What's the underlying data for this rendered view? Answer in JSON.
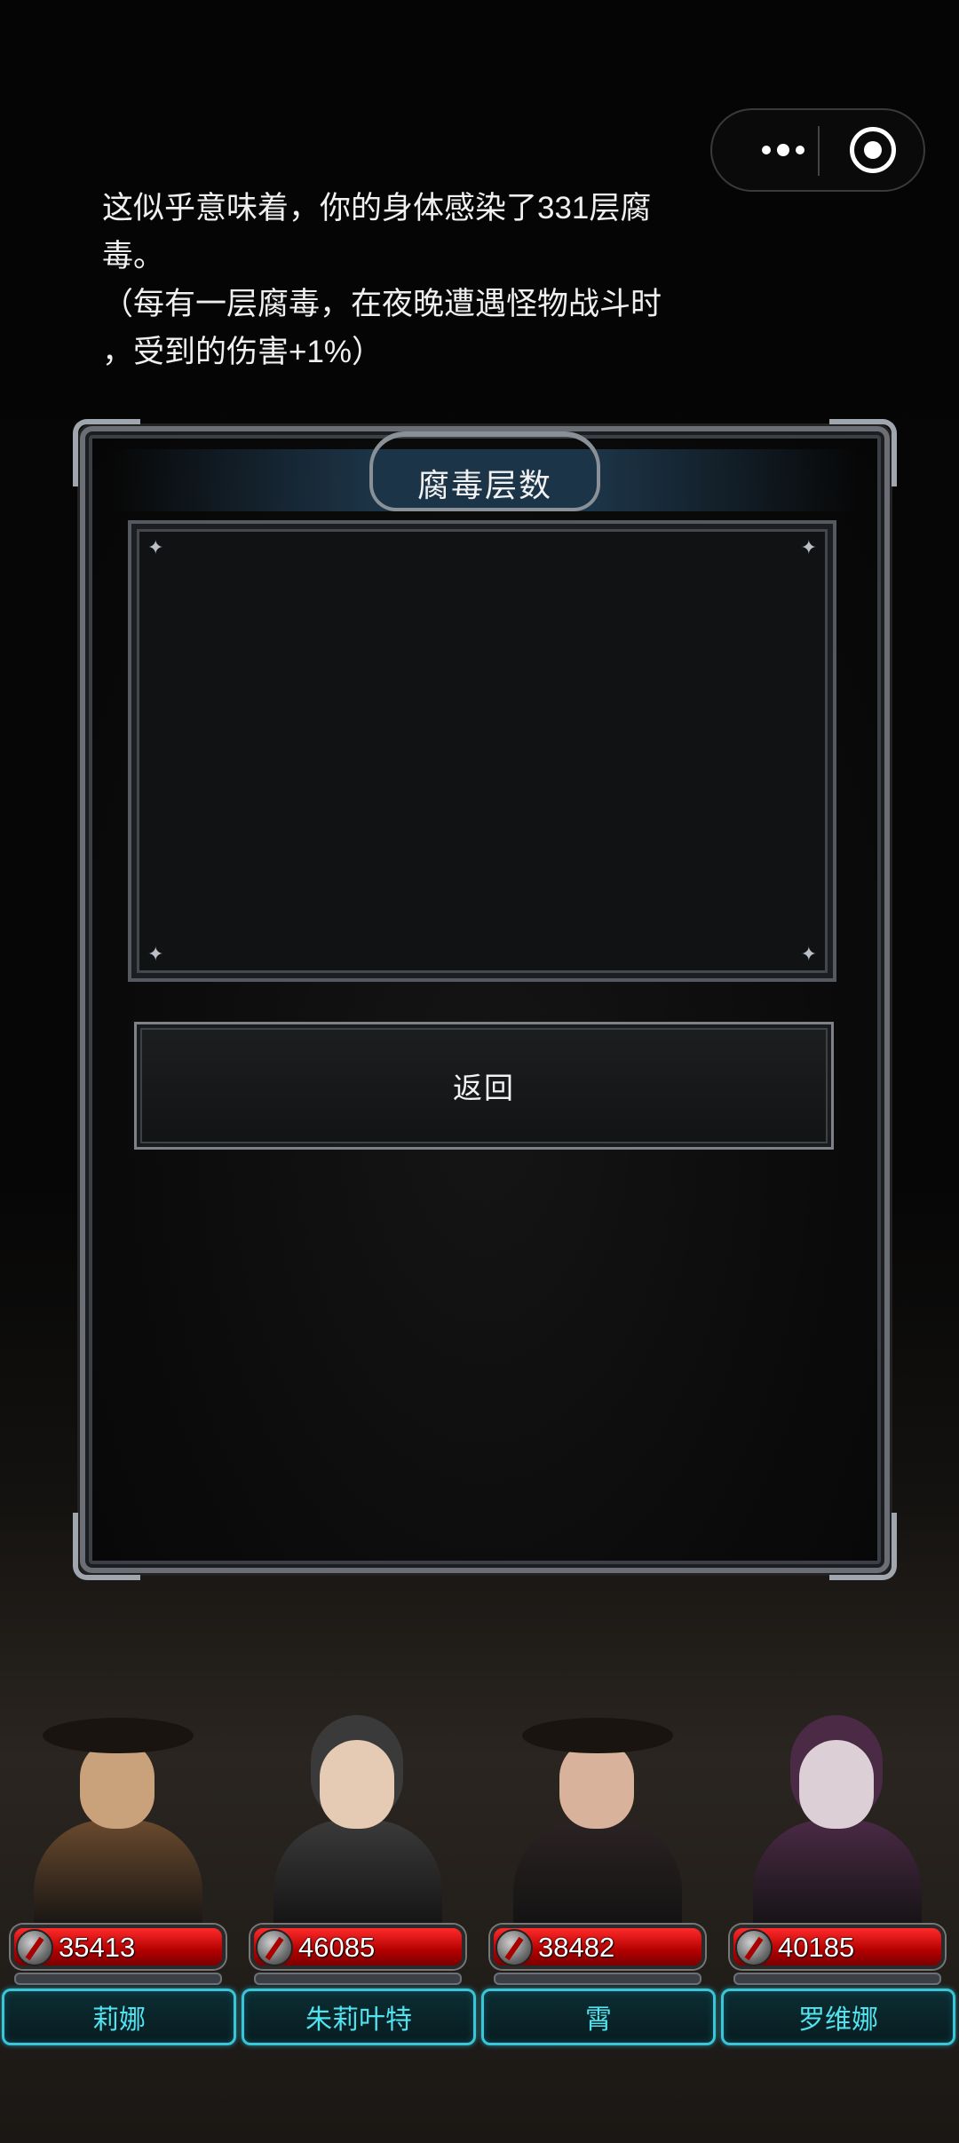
{
  "capsule": {
    "more_icon": "more-dots-icon",
    "close_icon": "target-close-icon"
  },
  "dialog": {
    "title": "腐毒层数",
    "message": "这似乎意味着，你的身体感染了331层腐\n毒。\n（每有一层腐毒，在夜晚遭遇怪物战斗时\n，受到的伤害+1%）",
    "back_label": "返回"
  },
  "party": [
    {
      "name": "莉娜",
      "hp": "35413",
      "portrait_color": "#6a4a2e",
      "skin": "#c9a27c",
      "hat": true
    },
    {
      "name": "朱莉叶特",
      "hp": "46085",
      "portrait_color": "#3b3a3a",
      "skin": "#e6cbb4",
      "hat": false
    },
    {
      "name": "霄",
      "hp": "38482",
      "portrait_color": "#2b2323",
      "skin": "#d8b29a",
      "hat": true
    },
    {
      "name": "罗维娜",
      "hp": "40185",
      "portrait_color": "#4a2a45",
      "skin": "#dcd0d6",
      "hat": false
    }
  ],
  "colors": {
    "hp_red": "#d10000",
    "name_cyan": "#4fe3f0",
    "frame_gray": "#8a9098"
  }
}
